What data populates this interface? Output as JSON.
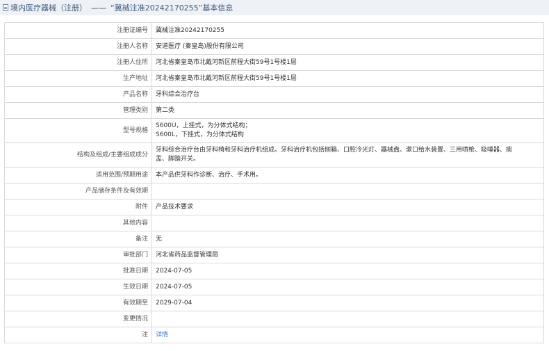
{
  "header": {
    "section": "境内医疗器械（注册）",
    "separator": "——",
    "title": "“冀械注准20242170255”基本信息"
  },
  "rows": [
    {
      "label": "注册证编号",
      "value": "冀械注准20242170255"
    },
    {
      "label": "注册人名称",
      "value": "安道医疗 (秦皇岛)股份有限公司"
    },
    {
      "label": "注册人住所",
      "value": "河北省秦皇岛市北戴河新区前程大街59号1号楼1层"
    },
    {
      "label": "生产地址",
      "value": "河北省秦皇岛市北戴河新区前程大街59号1号楼1层"
    },
    {
      "label": "产品名称",
      "value": "牙科综合治疗台"
    },
    {
      "label": "管理类别",
      "value": "第二类"
    },
    {
      "label": "型号规格",
      "lines": [
        "S600U，上挂式，为分体式结构；",
        "S600L，下挂式，为分体式结构"
      ]
    },
    {
      "label": "结构及组成/主要组成成分",
      "lines": [
        "牙科综合治疗台由牙科椅和牙科治疗机组成。牙科治疗机包括侧箱、口腔冷光灯、器械盘、漱口给水装置、三用喷枪、吸唾器、痰",
        "盂、脚踏开关。"
      ]
    },
    {
      "label": "适用范围/预期用途",
      "value": "本产品供牙科作诊断、治疗、手术用。"
    },
    {
      "label": "产品储存条件及有效期",
      "value": ""
    },
    {
      "label": "附件",
      "value": "产品技术要求"
    },
    {
      "label": "其他内容",
      "value": ""
    },
    {
      "label": "备注",
      "value": "无"
    },
    {
      "label": "审批部门",
      "value": "河北省药品监督管理局"
    },
    {
      "label": "批准日期",
      "value": "2024-07-05"
    },
    {
      "label": "生效日期",
      "value": "2024-07-05"
    },
    {
      "label": "有效期至",
      "value": "2029-07-04"
    },
    {
      "label": "变更情况",
      "value": ""
    },
    {
      "label": "注",
      "value": "详情",
      "link": true
    }
  ]
}
